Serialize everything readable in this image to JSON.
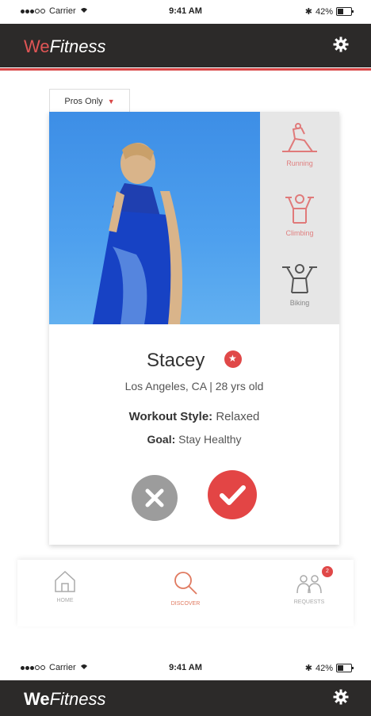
{
  "status_bar": {
    "carrier": "Carrier",
    "time": "9:41 AM",
    "battery": "42%"
  },
  "app": {
    "brand_we": "We",
    "brand_fitness": "Fitness",
    "settings_icon": "gear-icon"
  },
  "filter_tab": {
    "label": "Pros Only"
  },
  "profile": {
    "name": "Stacey",
    "location_age": "Los Angeles, CA  | 28 yrs old",
    "workout_style_label": "Workout Style:",
    "workout_style_value": "Relaxed",
    "goal_label": "Goal:",
    "goal_value": "Stay Healthy"
  },
  "activities": [
    {
      "label": "Running",
      "icon": "running-icon",
      "active": true
    },
    {
      "label": "Climbing",
      "icon": "climbing-icon",
      "active": true
    },
    {
      "label": "Biking",
      "icon": "weightlifting-icon",
      "active": false
    }
  ],
  "tabbar": {
    "items": [
      {
        "label": "Home",
        "icon": "home-icon"
      },
      {
        "label": "Discover",
        "icon": "search-icon"
      },
      {
        "label": "Requests",
        "icon": "people-icon"
      }
    ],
    "requests_badge": "2"
  },
  "colors": {
    "accent": "#e04848",
    "appbar": "#2c2a29"
  },
  "second_screen": {
    "carrier": "Carrier",
    "time": "9:41 AM",
    "battery": "42%",
    "brand_we": "We",
    "brand_fitness": "Fitness"
  }
}
